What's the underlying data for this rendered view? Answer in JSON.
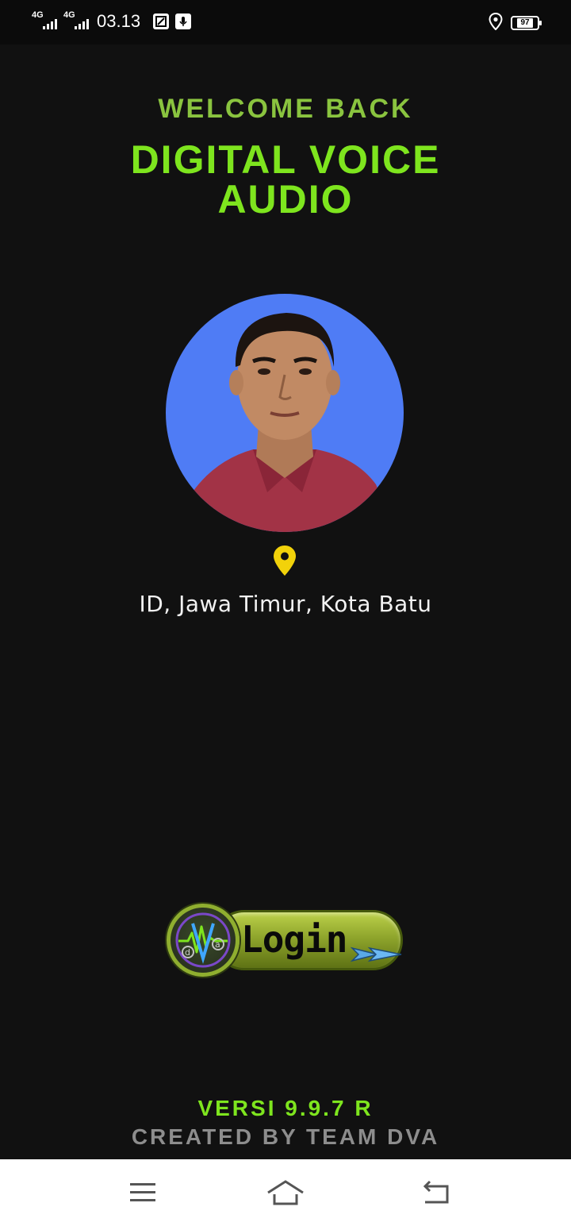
{
  "status_bar": {
    "network1": "4G",
    "network2": "4G",
    "time": "03.13",
    "battery": "97"
  },
  "header": {
    "welcome": "WELCOME BACK",
    "title_line1": "DIGITAL VOICE",
    "title_line2": "AUDIO"
  },
  "profile": {
    "avatar_icon": "user-photo",
    "location_icon": "map-pin-icon",
    "location": "ID, Jawa Timur, Kota Batu"
  },
  "login": {
    "label": "Login",
    "logo_text": "dVa"
  },
  "footer": {
    "version": "VERSI 9.9.7  R",
    "credit": "CREATED BY TEAM DVA"
  },
  "colors": {
    "accent": "#7ee51e",
    "welcome": "#8ac43f",
    "avatar_bg": "#4f7cf5",
    "pin": "#f2d20a",
    "credit": "#8d8d8d"
  }
}
